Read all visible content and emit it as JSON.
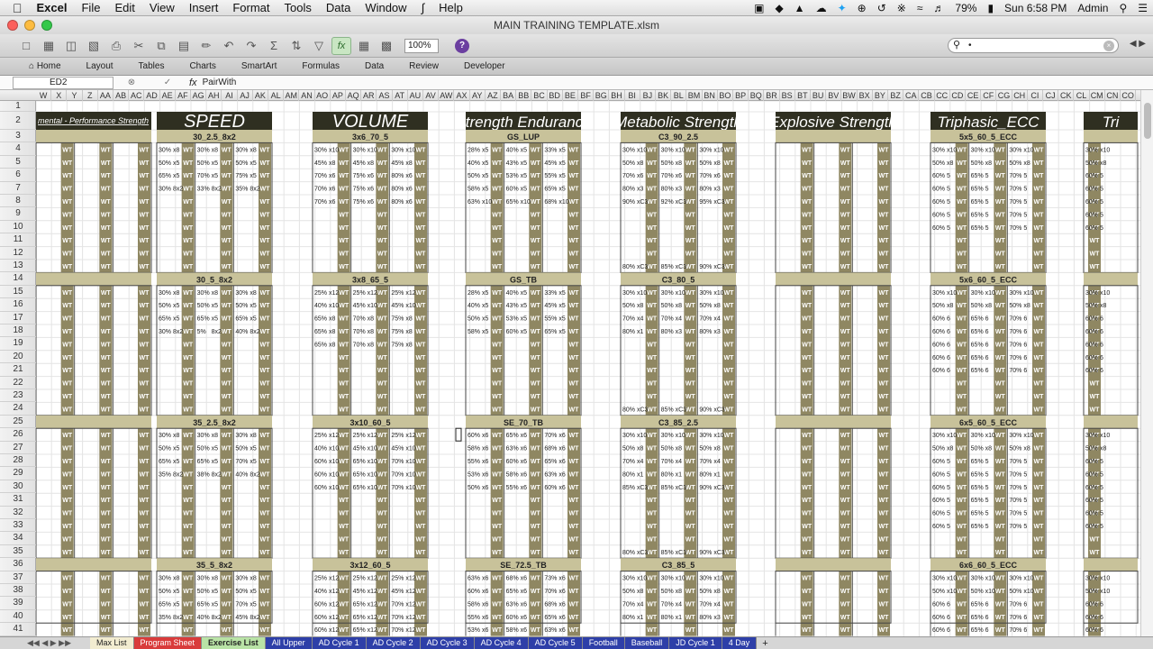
{
  "menubar": {
    "apple": "",
    "app": "Excel",
    "items": [
      "File",
      "Edit",
      "View",
      "Insert",
      "Format",
      "Tools",
      "Data",
      "Window",
      "Help"
    ],
    "battery": "79%",
    "clock": "Sun 6:58 PM",
    "user": "Admin"
  },
  "window": {
    "title": "MAIN TRAINING TEMPLATE.xlsm"
  },
  "toolbar": {
    "zoom": "100%",
    "search_value": "•"
  },
  "ribbon": {
    "tabs": [
      "Home",
      "Layout",
      "Tables",
      "Charts",
      "SmartArt",
      "Formulas",
      "Data",
      "Review",
      "Developer"
    ]
  },
  "formula_bar": {
    "name_box": "ED2",
    "fx": "fx",
    "value": "PairWith"
  },
  "columns": [
    "W",
    "X",
    "Y",
    "Z",
    "AA",
    "AB",
    "AC",
    "AD",
    "AE",
    "AF",
    "AG",
    "AH",
    "AI",
    "AJ",
    "AK",
    "AL",
    "AM",
    "AN",
    "AO",
    "AP",
    "AQ",
    "AR",
    "AS",
    "AT",
    "AU",
    "AV",
    "AW",
    "AX",
    "AY",
    "AZ",
    "BA",
    "BB",
    "BC",
    "BD",
    "BE",
    "BF",
    "BG",
    "BH",
    "BI",
    "BJ",
    "BK",
    "BL",
    "BM",
    "BN",
    "BO",
    "BP",
    "BQ",
    "BR",
    "BS",
    "BT",
    "BU",
    "BV",
    "BW",
    "BX",
    "BY",
    "BZ",
    "CA",
    "CB",
    "CC",
    "CD",
    "CE",
    "CF",
    "CG",
    "CH",
    "CI",
    "CJ",
    "CK",
    "CL",
    "CM",
    "CN",
    "CO"
  ],
  "rows": [
    "1",
    "2",
    "3",
    "4",
    "5",
    "6",
    "7",
    "8",
    "9",
    "10",
    "11",
    "12",
    "13",
    "14",
    "15",
    "16",
    "17",
    "18",
    "19",
    "20",
    "21",
    "22",
    "23",
    "24",
    "25",
    "26",
    "27",
    "28",
    "29",
    "30",
    "31",
    "32",
    "33",
    "34",
    "35",
    "36",
    "37",
    "38",
    "39",
    "40",
    "41"
  ],
  "sections": [
    {
      "title": "mental - Performance Strength",
      "blocks": [
        "",
        "",
        "",
        ""
      ]
    },
    {
      "title": "SPEED",
      "blocks": [
        "30_2.5_8x2",
        "30_5_8x2",
        "35_2.5_8x2",
        "35_5_8x2"
      ],
      "cells": [
        [
          [
            "30%",
            "x8",
            "30%",
            "x8",
            "30%",
            "x8"
          ],
          [
            "50%",
            "x5",
            "50%",
            "x5",
            "50%",
            "x5"
          ],
          [
            "65%",
            "x5",
            "70%",
            "x5",
            "75%",
            "x5"
          ],
          [
            "30%",
            "8x2",
            "33%",
            "8x2",
            "35%",
            "8x2"
          ]
        ],
        [
          [
            "30%",
            "x8",
            "30%",
            "x8",
            "30%",
            "x8"
          ],
          [
            "50%",
            "x5",
            "50%",
            "x5",
            "50%",
            "x5"
          ],
          [
            "65%",
            "x5",
            "65%",
            "x5",
            "65%",
            "x5"
          ],
          [
            "30%",
            "8x2",
            "5%",
            "8x2",
            "40%",
            "8x2"
          ]
        ],
        [
          [
            "30%",
            "x8",
            "30%",
            "x8",
            "30%",
            "x8"
          ],
          [
            "50%",
            "x5",
            "50%",
            "x5",
            "50%",
            "x5"
          ],
          [
            "65%",
            "x5",
            "65%",
            "x5",
            "70%",
            "x5"
          ],
          [
            "35%",
            "8x2",
            "38%",
            "8x2",
            "40%",
            "8x2"
          ]
        ],
        [
          [
            "30%",
            "x8",
            "30%",
            "x8",
            "30%",
            "x8"
          ],
          [
            "50%",
            "x5",
            "50%",
            "x5",
            "50%",
            "x5"
          ],
          [
            "65%",
            "x5",
            "65%",
            "x5",
            "70%",
            "x5"
          ],
          [
            "35%",
            "8x2",
            "40%",
            "8x2",
            "45%",
            "8x2"
          ]
        ]
      ]
    },
    {
      "title": "VOLUME",
      "blocks": [
        "3x6_70_5",
        "3x8_65_5",
        "3x10_60_5",
        "3x12_60_5"
      ],
      "cells": [
        [
          [
            "30%",
            "x10",
            "30%",
            "x10",
            "30%",
            "x10"
          ],
          [
            "45%",
            "x8",
            "45%",
            "x8",
            "45%",
            "x8"
          ],
          [
            "70%",
            "x6",
            "75%",
            "x6",
            "80%",
            "x6"
          ],
          [
            "70%",
            "x6",
            "75%",
            "x6",
            "80%",
            "x6"
          ],
          [
            "70%",
            "x6",
            "75%",
            "x6",
            "80%",
            "x6"
          ]
        ],
        [
          [
            "25%",
            "x12",
            "25%",
            "x12",
            "25%",
            "x12"
          ],
          [
            "40%",
            "x10",
            "45%",
            "x10",
            "45%",
            "x10"
          ],
          [
            "65%",
            "x8",
            "70%",
            "x8",
            "75%",
            "x8"
          ],
          [
            "65%",
            "x8",
            "70%",
            "x8",
            "75%",
            "x8"
          ],
          [
            "65%",
            "x8",
            "70%",
            "x8",
            "75%",
            "x8"
          ]
        ],
        [
          [
            "25%",
            "x12",
            "25%",
            "x12",
            "25%",
            "x12"
          ],
          [
            "40%",
            "x10",
            "45%",
            "x10",
            "45%",
            "x10"
          ],
          [
            "60%",
            "x10",
            "65%",
            "x10",
            "70%",
            "x10"
          ],
          [
            "60%",
            "x10",
            "65%",
            "x10",
            "70%",
            "x10"
          ],
          [
            "60%",
            "x10",
            "65%",
            "x10",
            "70%",
            "x10"
          ]
        ],
        [
          [
            "25%",
            "x12",
            "25%",
            "x12",
            "25%",
            "x12"
          ],
          [
            "40%",
            "x12",
            "45%",
            "x12",
            "45%",
            "x12"
          ],
          [
            "60%",
            "x12",
            "65%",
            "x12",
            "70%",
            "x12"
          ],
          [
            "60%",
            "x12",
            "65%",
            "x12",
            "70%",
            "x12"
          ],
          [
            "60%",
            "x12",
            "65%",
            "x12",
            "70%",
            "x12"
          ]
        ]
      ]
    },
    {
      "title": "Strength Endurance",
      "blocks": [
        "GS_LUP",
        "GS_TB",
        "SE_70_TB",
        "SE_72.5_TB"
      ],
      "cells": [
        [
          [
            "28%",
            "x5",
            "40%",
            "x5",
            "33%",
            "x5"
          ],
          [
            "40%",
            "x5",
            "43%",
            "x5",
            "45%",
            "x5"
          ],
          [
            "50%",
            "x5",
            "53%",
            "x5",
            "55%",
            "x5"
          ],
          [
            "58%",
            "x5",
            "60%",
            "x5",
            "65%",
            "x5"
          ],
          [
            "63%",
            "x10",
            "65%",
            "x10",
            "68%",
            "x10"
          ]
        ],
        [
          [
            "28%",
            "x5",
            "40%",
            "x5",
            "33%",
            "x5"
          ],
          [
            "40%",
            "x5",
            "43%",
            "x5",
            "45%",
            "x5"
          ],
          [
            "50%",
            "x5",
            "53%",
            "x5",
            "55%",
            "x5"
          ],
          [
            "58%",
            "x5",
            "60%",
            "x5",
            "65%",
            "x5"
          ]
        ],
        [
          [
            "60%",
            "x6",
            "65%",
            "x6",
            "70%",
            "x6"
          ],
          [
            "58%",
            "x6",
            "63%",
            "x6",
            "68%",
            "x6"
          ],
          [
            "55%",
            "x6",
            "60%",
            "x6",
            "65%",
            "x6"
          ],
          [
            "53%",
            "x6",
            "58%",
            "x6",
            "63%",
            "x6"
          ],
          [
            "50%",
            "x6",
            "55%",
            "x6",
            "60%",
            "x6"
          ]
        ],
        [
          [
            "63%",
            "x6",
            "68%",
            "x6",
            "73%",
            "x6"
          ],
          [
            "60%",
            "x6",
            "65%",
            "x6",
            "70%",
            "x6"
          ],
          [
            "58%",
            "x6",
            "63%",
            "x6",
            "68%",
            "x6"
          ],
          [
            "55%",
            "x6",
            "60%",
            "x6",
            "65%",
            "x6"
          ],
          [
            "53%",
            "x6",
            "58%",
            "x6",
            "63%",
            "x6"
          ]
        ]
      ]
    },
    {
      "title": "Metabolic Strength",
      "blocks": [
        "C3_90_2.5",
        "C3_80_5",
        "C3_85_2.5",
        "C3_85_5"
      ],
      "cells": [
        [
          [
            "30%",
            "x10",
            "30%",
            "x10",
            "30%",
            "x10"
          ],
          [
            "50%",
            "x8",
            "50%",
            "x8",
            "50%",
            "x8"
          ],
          [
            "70%",
            "x6",
            "70%",
            "x6",
            "70%",
            "x6"
          ],
          [
            "80%",
            "x3",
            "80%",
            "x3",
            "80%",
            "x3"
          ],
          [
            "90%",
            "xC3",
            "92%",
            "xC3",
            "95%",
            "xC3"
          ]
        ],
        [
          [
            "30%",
            "x10",
            "30%",
            "x10",
            "30%",
            "x10"
          ],
          [
            "50%",
            "x8",
            "50%",
            "x8",
            "50%",
            "x8"
          ],
          [
            "70%",
            "x4",
            "70%",
            "x4",
            "70%",
            "x4"
          ],
          [
            "80%",
            "x1",
            "80%",
            "x3",
            "80%",
            "x3"
          ]
        ],
        [
          [
            "30%",
            "x10",
            "30%",
            "x10",
            "30%",
            "x10"
          ],
          [
            "50%",
            "x8",
            "50%",
            "x8",
            "50%",
            "x8"
          ],
          [
            "70%",
            "x4",
            "70%",
            "x4",
            "70%",
            "x4"
          ],
          [
            "80%",
            "x1",
            "80%",
            "x1",
            "80%",
            "x1"
          ],
          [
            "85%",
            "xC3",
            "85%",
            "xC3",
            "90%",
            "xC3"
          ]
        ],
        [
          [
            "30%",
            "x10",
            "30%",
            "x10",
            "30%",
            "x10"
          ],
          [
            "50%",
            "x8",
            "50%",
            "x8",
            "50%",
            "x8"
          ],
          [
            "70%",
            "x4",
            "70%",
            "x4",
            "70%",
            "x4"
          ],
          [
            "80%",
            "x1",
            "80%",
            "x1",
            "80%",
            "x3"
          ]
        ]
      ],
      "tails": [
        [
          "80%",
          "xC3",
          "85%",
          "xC3",
          "90%",
          "xC3"
        ],
        [
          "80%",
          "xC3",
          "85%",
          "xC3",
          "90%",
          "xC3"
        ],
        [
          "80%",
          "xC3",
          "85%",
          "xC3",
          "90%",
          "xC3"
        ]
      ]
    },
    {
      "title": "Explosive Strength",
      "blocks": [
        "",
        "",
        "",
        ""
      ]
    },
    {
      "title": "Triphasic_ECC",
      "blocks": [
        "5x5_60_5_ECC",
        "5x6_60_5_ECC",
        "6x5_60_5_ECC",
        "6x6_60_5_ECC"
      ],
      "cells": [
        [
          [
            "30%",
            "x10",
            "30%",
            "x10",
            "30%",
            "x10"
          ],
          [
            "50%",
            "x8",
            "50%",
            "x8",
            "50%",
            "x8"
          ],
          [
            "60%",
            "5",
            "65%",
            "5",
            "70%",
            "5"
          ],
          [
            "60%",
            "5",
            "65%",
            "5",
            "70%",
            "5"
          ],
          [
            "60%",
            "5",
            "65%",
            "5",
            "70%",
            "5"
          ],
          [
            "60%",
            "5",
            "65%",
            "5",
            "70%",
            "5"
          ],
          [
            "60%",
            "5",
            "65%",
            "5",
            "70%",
            "5"
          ]
        ],
        [
          [
            "30%",
            "x10",
            "30%",
            "x10",
            "30%",
            "x10"
          ],
          [
            "50%",
            "x8",
            "50%",
            "x8",
            "50%",
            "x8"
          ],
          [
            "60%",
            "6",
            "65%",
            "6",
            "70%",
            "6"
          ],
          [
            "60%",
            "6",
            "65%",
            "6",
            "70%",
            "6"
          ],
          [
            "60%",
            "6",
            "65%",
            "6",
            "70%",
            "6"
          ],
          [
            "60%",
            "6",
            "65%",
            "6",
            "70%",
            "6"
          ],
          [
            "60%",
            "6",
            "65%",
            "6",
            "70%",
            "6"
          ]
        ],
        [
          [
            "30%",
            "x10",
            "30%",
            "x10",
            "30%",
            "x10"
          ],
          [
            "50%",
            "x8",
            "50%",
            "x8",
            "50%",
            "x8"
          ],
          [
            "60%",
            "5",
            "65%",
            "5",
            "70%",
            "5"
          ],
          [
            "60%",
            "5",
            "65%",
            "5",
            "70%",
            "5"
          ],
          [
            "60%",
            "5",
            "65%",
            "5",
            "70%",
            "5"
          ],
          [
            "60%",
            "5",
            "65%",
            "5",
            "70%",
            "5"
          ],
          [
            "60%",
            "5",
            "65%",
            "5",
            "70%",
            "5"
          ],
          [
            "60%",
            "5",
            "65%",
            "5",
            "70%",
            "5"
          ]
        ],
        [
          [
            "30%",
            "x10",
            "30%",
            "x10",
            "30%",
            "x10"
          ],
          [
            "50%",
            "x10",
            "50%",
            "x10",
            "50%",
            "x10"
          ],
          [
            "60%",
            "6",
            "65%",
            "6",
            "70%",
            "6"
          ],
          [
            "60%",
            "6",
            "65%",
            "6",
            "70%",
            "6"
          ],
          [
            "60%",
            "6",
            "65%",
            "6",
            "70%",
            "6"
          ]
        ]
      ]
    },
    {
      "title": "Tri",
      "blocks": [
        "",
        "",
        "",
        ""
      ],
      "cells": [
        [
          [
            "30%",
            "x10"
          ],
          [
            "50%",
            "x8"
          ],
          [
            "60%",
            "5"
          ],
          [
            "60%",
            "5"
          ],
          [
            "60%",
            "5"
          ],
          [
            "60%",
            "5"
          ],
          [
            "60%",
            "5"
          ]
        ],
        [
          [
            "30%",
            "x10"
          ],
          [
            "50%",
            "x8"
          ],
          [
            "60%",
            "6"
          ],
          [
            "60%",
            "6"
          ],
          [
            "60%",
            "6"
          ],
          [
            "60%",
            "6"
          ],
          [
            "60%",
            "6"
          ]
        ],
        [
          [
            "30%",
            "x10"
          ],
          [
            "50%",
            "x8"
          ],
          [
            "60%",
            "5"
          ],
          [
            "60%",
            "5"
          ],
          [
            "60%",
            "5"
          ],
          [
            "60%",
            "5"
          ],
          [
            "60%",
            "5"
          ],
          [
            "60%",
            "5"
          ]
        ],
        [
          [
            "30%",
            "x10"
          ],
          [
            "50%",
            "x10"
          ],
          [
            "60%",
            "6"
          ],
          [
            "60%",
            "6"
          ],
          [
            "60%",
            "6"
          ]
        ]
      ]
    }
  ],
  "wt_label": "WT",
  "sheet_tabs": [
    "Max List",
    "Program Sheet",
    "Exercise List",
    "All Upper",
    "AD Cycle 1",
    "AD Cycle 2",
    "AD Cycle 3",
    "AD Cycle 4",
    "AD Cycle 5",
    "Football",
    "Baseball",
    "JD Cycle 1",
    "4 Day"
  ],
  "colors": {
    "header_band": "#2f2f21",
    "subheader_band": "#c8c29a",
    "wt_fill": "#8f8762",
    "tab_program": "#d93b3b",
    "tab_exercise": "#b9e3a6",
    "tab_max": "#f2ecd0",
    "tab_blue": "#2e3fa8"
  }
}
